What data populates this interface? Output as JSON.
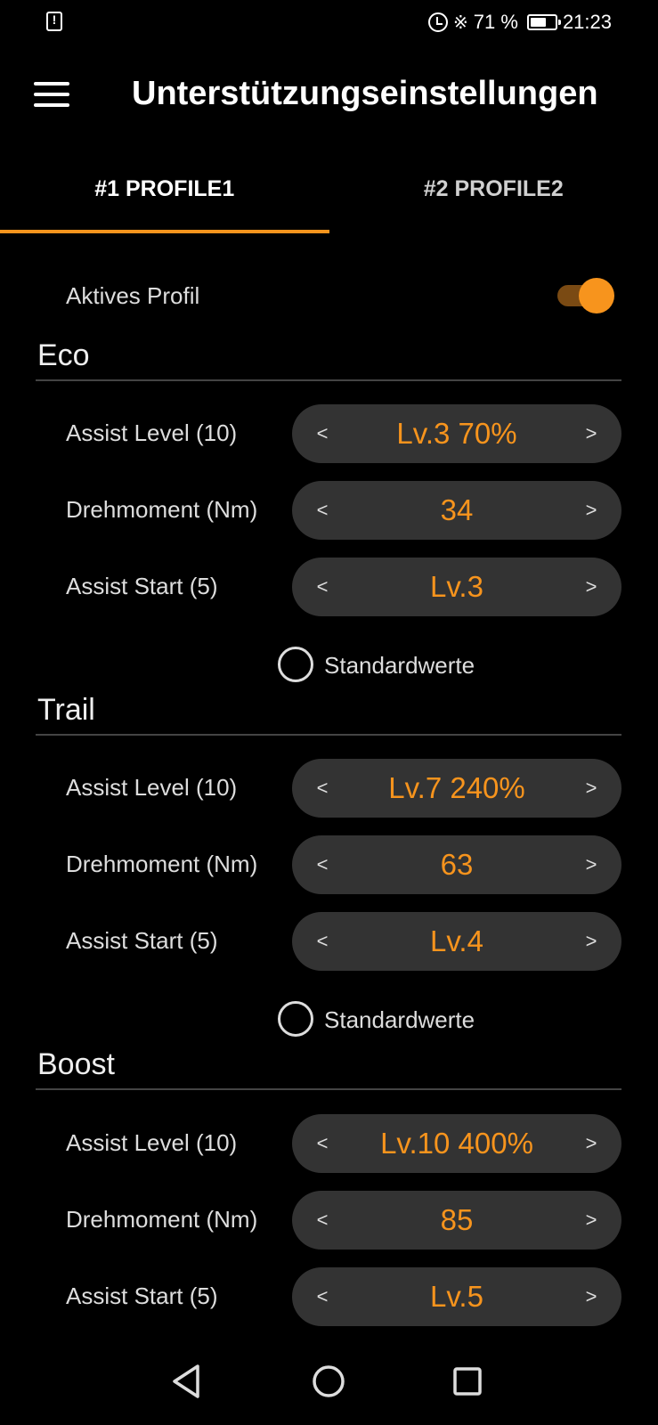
{
  "status_bar": {
    "battery": "71 %",
    "time": "21:23",
    "battery_level": 0.71
  },
  "header": {
    "title": "Unterstützungseinstellungen"
  },
  "tabs": [
    {
      "label": "#1 PROFILE1",
      "active": true
    },
    {
      "label": "#2 PROFILE2",
      "active": false
    }
  ],
  "profile": {
    "active_label": "Aktives Profil",
    "active": true
  },
  "sections": [
    {
      "title": "Eco",
      "rows": [
        {
          "label": "Assist Level (10)",
          "value": "Lv.3 70%"
        },
        {
          "label": "Drehmoment (Nm)",
          "value": "34"
        },
        {
          "label": "Assist Start (5)",
          "value": "Lv.3"
        }
      ],
      "defaults_label": "Standardwerte"
    },
    {
      "title": "Trail",
      "rows": [
        {
          "label": "Assist Level (10)",
          "value": "Lv.7 240%"
        },
        {
          "label": "Drehmoment (Nm)",
          "value": "63"
        },
        {
          "label": "Assist Start (5)",
          "value": "Lv.4"
        }
      ],
      "defaults_label": "Standardwerte"
    },
    {
      "title": "Boost",
      "rows": [
        {
          "label": "Assist Level (10)",
          "value": "Lv.10 400%"
        },
        {
          "label": "Drehmoment (Nm)",
          "value": "85"
        },
        {
          "label": "Assist Start (5)",
          "value": "Lv.5"
        }
      ]
    }
  ],
  "stepper_glyphs": {
    "prev": "<",
    "next": ">"
  },
  "colors": {
    "accent": "#f7941d",
    "background": "#000000",
    "stepper_bg": "#333333"
  }
}
